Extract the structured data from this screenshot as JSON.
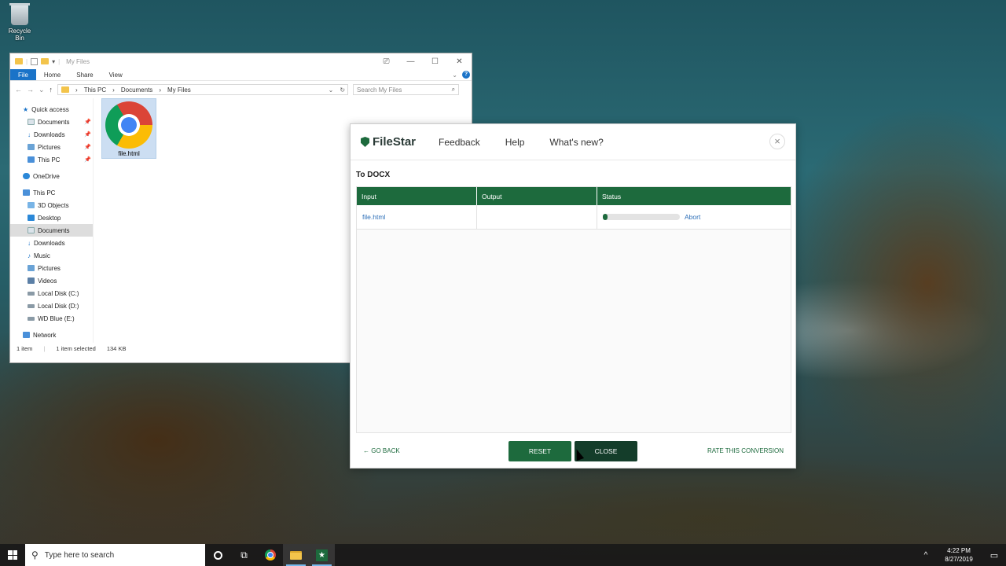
{
  "desktop": {
    "recycle_bin_label": "Recycle Bin"
  },
  "explorer": {
    "title": "My Files",
    "window_controls": [
      "—",
      "☐",
      "✕"
    ],
    "ribbon_tabs": [
      "File",
      "Home",
      "Share",
      "View"
    ],
    "breadcrumb": [
      "This PC",
      "Documents",
      "My Files"
    ],
    "search_placeholder": "Search My Files",
    "nav": {
      "quick_access": "Quick access",
      "quick_items": [
        "Documents",
        "Downloads",
        "Pictures",
        "This PC"
      ],
      "onedrive": "OneDrive",
      "this_pc": "This PC",
      "pc_items": [
        "3D Objects",
        "Desktop",
        "Documents",
        "Downloads",
        "Music",
        "Pictures",
        "Videos",
        "Local Disk (C:)",
        "Local Disk (D:)",
        "WD Blue (E:)"
      ],
      "network": "Network"
    },
    "file": {
      "name": "file.html"
    },
    "status": {
      "count": "1 item",
      "selected": "1 item selected",
      "size": "134 KB"
    }
  },
  "filestar": {
    "brand": "FileStar",
    "nav": [
      "Feedback",
      "Help",
      "What's new?"
    ],
    "section_title": "To DOCX",
    "columns": [
      "Input",
      "Output",
      "Status"
    ],
    "rows": [
      {
        "input": "file.html",
        "output": "",
        "progress": 0.05,
        "action": "Abort"
      }
    ],
    "go_back": "GO BACK",
    "reset": "RESET",
    "close": "CLOSE",
    "rate": "RATE THIS CONVERSION",
    "colors": {
      "primary": "#1d6a3d",
      "dark": "#143d2a",
      "link": "#2d6fb8"
    }
  },
  "taskbar": {
    "search_placeholder": "Type here to search",
    "time": "4:22 PM",
    "date": "8/27/2019"
  }
}
